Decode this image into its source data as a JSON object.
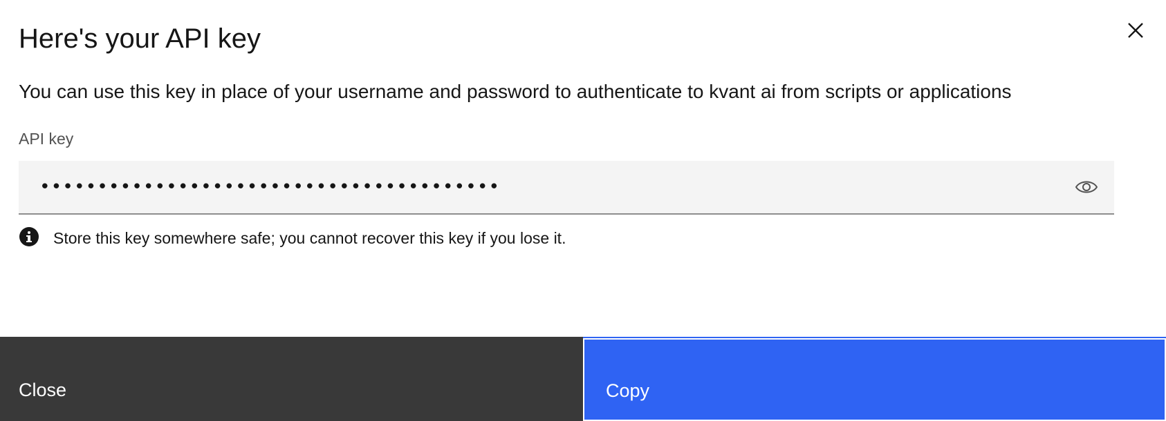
{
  "modal": {
    "title": "Here's your API key",
    "description": "You can use this key in place of your username and password to authenticate to kvant ai from scripts or applications",
    "close_icon": "close-icon"
  },
  "api_key_field": {
    "label": "API key",
    "masked_value": "••••••••••••••••••••••••••••••••••••••••",
    "input_type": "password",
    "reveal_icon": "eye-icon"
  },
  "helper": {
    "icon": "info-icon",
    "text": "Store this key somewhere safe; you cannot recover this key if you lose it."
  },
  "footer": {
    "close_label": "Close",
    "copy_label": "Copy"
  },
  "colors": {
    "primary": "#2f63f3",
    "secondary": "#393939",
    "field_bg": "#f4f4f4"
  }
}
